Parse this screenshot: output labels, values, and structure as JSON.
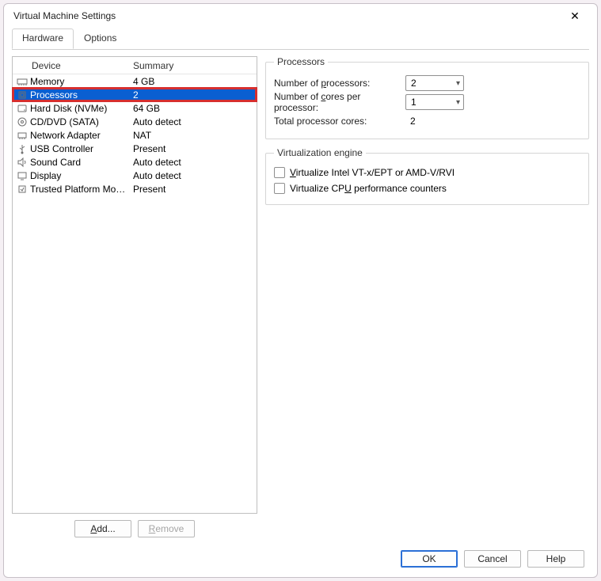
{
  "window": {
    "title": "Virtual Machine Settings"
  },
  "tabs": {
    "hardware": "Hardware",
    "options": "Options"
  },
  "list": {
    "header_device": "Device",
    "header_summary": "Summary",
    "rows": [
      {
        "icon": "memory-icon",
        "device": "Memory",
        "summary": "4 GB",
        "selected": false
      },
      {
        "icon": "cpu-icon",
        "device": "Processors",
        "summary": "2",
        "selected": true
      },
      {
        "icon": "hdd-icon",
        "device": "Hard Disk (NVMe)",
        "summary": "64 GB",
        "selected": false
      },
      {
        "icon": "disc-icon",
        "device": "CD/DVD (SATA)",
        "summary": "Auto detect",
        "selected": false
      },
      {
        "icon": "nic-icon",
        "device": "Network Adapter",
        "summary": "NAT",
        "selected": false
      },
      {
        "icon": "usb-icon",
        "device": "USB Controller",
        "summary": "Present",
        "selected": false
      },
      {
        "icon": "sound-icon",
        "device": "Sound Card",
        "summary": "Auto detect",
        "selected": false
      },
      {
        "icon": "display-icon",
        "device": "Display",
        "summary": "Auto detect",
        "selected": false
      },
      {
        "icon": "tpm-icon",
        "device": "Trusted Platform Mo…",
        "summary": "Present",
        "selected": false
      }
    ]
  },
  "buttons": {
    "add": "Add...",
    "remove": "Remove",
    "ok": "OK",
    "cancel": "Cancel",
    "help": "Help"
  },
  "procs": {
    "legend": "Processors",
    "num_processors_label_pre": "Number of ",
    "num_processors_label_u": "p",
    "num_processors_label_post": "rocessors:",
    "num_processors_value": "2",
    "cores_label_pre": "Number of ",
    "cores_label_u": "c",
    "cores_label_post": "ores per processor:",
    "cores_value": "1",
    "total_label": "Total processor cores:",
    "total_value": "2"
  },
  "virt": {
    "legend": "Virtualization engine",
    "vtx_pre": "",
    "vtx_u": "V",
    "vtx_post": "irtualize Intel VT-x/EPT or AMD-V/RVI",
    "perf_pre": "Virtualize CP",
    "perf_u": "U",
    "perf_post": " performance counters"
  }
}
